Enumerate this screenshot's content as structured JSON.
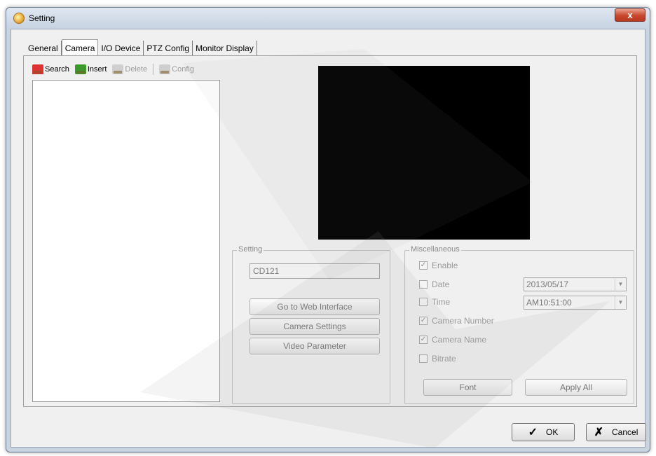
{
  "window": {
    "title": "Setting",
    "close_symbol": "x"
  },
  "tabs": [
    {
      "label": "General"
    },
    {
      "label": "Camera"
    },
    {
      "label": "I/O Device"
    },
    {
      "label": "PTZ Config"
    },
    {
      "label": "Monitor Display"
    }
  ],
  "toolbar": {
    "search": "Search",
    "insert": "Insert",
    "delete": "Delete",
    "config": "Config"
  },
  "setting": {
    "legend": "Setting",
    "camera_name_value": "CD121",
    "web_interface": "Go to Web Interface",
    "camera_settings": "Camera Settings",
    "video_parameter": "Video Parameter"
  },
  "misc": {
    "legend": "Miscellaneous",
    "enable": "Enable",
    "date": "Date",
    "time": "Time",
    "camera_number": "Camera Number",
    "camera_name": "Camera Name",
    "bitrate": "Bitrate",
    "date_value": "2013/05/17",
    "time_value": "AM10:51:00",
    "font": "Font",
    "apply_all": "Apply All"
  },
  "buttons": {
    "ok": "OK",
    "cancel": "Cancel"
  },
  "icons": {
    "check": "✓",
    "cross": "✗"
  }
}
